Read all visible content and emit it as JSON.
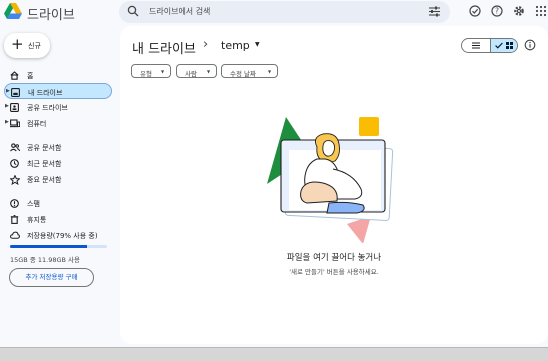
{
  "app": {
    "title": "드라이브"
  },
  "search": {
    "placeholder": "드라이브에서 검색"
  },
  "new_button": {
    "label": "신규"
  },
  "sidebar": {
    "items": [
      {
        "label": "홈",
        "icon": "home-icon"
      },
      {
        "label": "내 드라이브",
        "icon": "my-drive-icon",
        "active": true
      },
      {
        "label": "공유 드라이브",
        "icon": "shared-drive-icon"
      },
      {
        "label": "컴퓨터",
        "icon": "computer-icon"
      },
      {
        "label": "공유 문서함",
        "icon": "shared-with-me-icon"
      },
      {
        "label": "최근 문서함",
        "icon": "recent-icon"
      },
      {
        "label": "중요 문서함",
        "icon": "starred-icon"
      },
      {
        "label": "스팸",
        "icon": "spam-icon"
      },
      {
        "label": "휴지통",
        "icon": "trash-icon"
      },
      {
        "label": "저장용량(79% 사용 중)",
        "icon": "cloud-icon"
      }
    ],
    "storage": {
      "used_fraction": 0.79,
      "text": "15GB 중 11.98GB 사용"
    },
    "buy_storage": "추가 저장용량 구매"
  },
  "breadcrumb": {
    "root": "내 드라이브",
    "separator": "›",
    "current": "temp"
  },
  "filters": {
    "chips": [
      "유형",
      "사람",
      "수정 날짜"
    ]
  },
  "empty_state": {
    "title": "파일을 여기 끌어다 놓거나",
    "subtitle": "'새로 만들기' 버튼을 사용하세요."
  },
  "colors": {
    "accent": "#0b57d0",
    "active_nav": "#c2e7ff",
    "background": "#f7f9fc"
  }
}
